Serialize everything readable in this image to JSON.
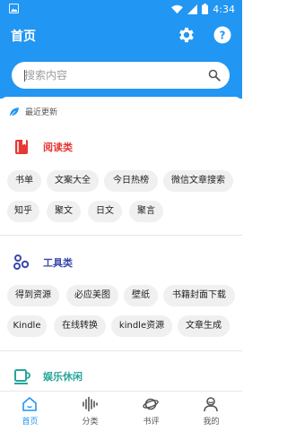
{
  "status_bar": {
    "time": "4:34"
  },
  "app_bar": {
    "title": "首页"
  },
  "search": {
    "placeholder": "搜索内容"
  },
  "recent": {
    "label": "最近更新"
  },
  "sections": [
    {
      "title": "阅读类",
      "color": "#e53935",
      "icon": "book-icon",
      "items": [
        "书单",
        "文案大全",
        "今日热榜",
        "微信文章搜索",
        "知乎",
        "聚文",
        "日文",
        "聚言"
      ]
    },
    {
      "title": "工具类",
      "color": "#3949ab",
      "icon": "tools-icon",
      "items": [
        "得到资源",
        "必应美图",
        "壁纸",
        "书籍封面下载",
        "Kindle",
        "在线转换",
        "kindle资源",
        "文章生成"
      ]
    },
    {
      "title": "娱乐休闲",
      "color": "#26a69a",
      "icon": "cup-icon",
      "items": []
    }
  ],
  "bottom_nav": [
    {
      "label": "首页",
      "icon": "home-icon",
      "active": true
    },
    {
      "label": "分类",
      "icon": "waveform-icon",
      "active": false
    },
    {
      "label": "书评",
      "icon": "planet-icon",
      "active": false
    },
    {
      "label": "我的",
      "icon": "user-icon",
      "active": false
    }
  ],
  "colors": {
    "primary": "#2196f3",
    "chip_bg": "#f0f0f0",
    "nav_active": "#2196f3",
    "nav_inactive": "#555555"
  }
}
